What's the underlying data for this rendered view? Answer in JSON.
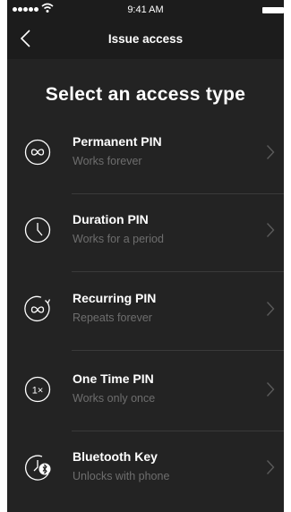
{
  "status_bar": {
    "time": "9:41 AM"
  },
  "nav": {
    "title": "Issue access"
  },
  "page": {
    "title": "Select an access type"
  },
  "options": [
    {
      "label": "Permanent PIN",
      "subtitle": "Works forever",
      "icon": "infinity-icon"
    },
    {
      "label": "Duration PIN",
      "subtitle": "Works for a period",
      "icon": "clock-icon"
    },
    {
      "label": "Recurring PIN",
      "subtitle": "Repeats forever",
      "icon": "recurring-infinity-icon"
    },
    {
      "label": "One Time PIN",
      "subtitle": "Works only once",
      "icon": "one-time-icon",
      "icon_text": "1×"
    },
    {
      "label": "Bluetooth Key",
      "subtitle": "Unlocks with phone",
      "icon": "bluetooth-clock-icon"
    }
  ]
}
